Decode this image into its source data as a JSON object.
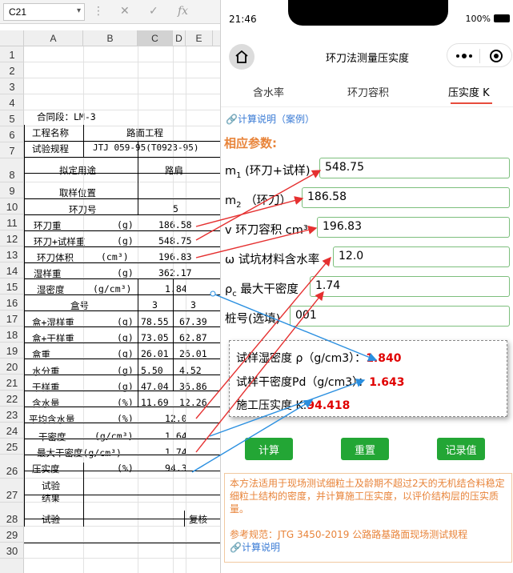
{
  "excel": {
    "name_box": "C21",
    "fx_label": "fx",
    "columns": [
      "A",
      "B",
      "C",
      "D",
      "E"
    ],
    "rows": [
      "1",
      "2",
      "3",
      "4",
      "5",
      "6",
      "7",
      "8",
      "9",
      "10",
      "11",
      "12",
      "13",
      "14",
      "15",
      "16",
      "17",
      "18",
      "19",
      "20",
      "21",
      "22",
      "23",
      "24",
      "25",
      "26",
      "27",
      "28",
      "29",
      "30"
    ],
    "contract": "合同段：LM-3",
    "project_label": "工程名称",
    "project_value": "路面工程",
    "spec_label": "试验规程",
    "spec_value": "JTJ 059-95(T0923-95)",
    "use_label": "拟定用途",
    "use_value": "路肩",
    "location_label": "取样位置",
    "ring_no_label": "环刀号",
    "ring_no_value": "5",
    "ring_weight_label": "环刀重",
    "ring_sample_label": "环刀+试样重",
    "ring_volume_label": "环刀体积",
    "wet_weight_label": "湿样重",
    "wet_density_label": "湿密度",
    "box_no_label": "盒号",
    "box_wet_label": "盒+湿样重",
    "box_dry_label": "盒+干样重",
    "box_label": "盒重",
    "water_label": "水分重",
    "dry_sample_label": "干样重",
    "moisture_label": "含水量",
    "avg_moisture_label": "平均含水量",
    "dry_density_label": "干密度",
    "max_dry_density_label": "最大干密度(g/cm³)",
    "compaction_label": "压实度",
    "result_label_1": "试验",
    "result_label_2": "结果",
    "tester_label": "试验",
    "reviewer_label": "复核",
    "unit_g": "(g)",
    "unit_density": "(g/cm³)",
    "unit_volume": "(cm³)",
    "unit_percent": "(%)",
    "ring_weight": "186.58",
    "ring_sample_weight": "548.75",
    "ring_volume": "196.83",
    "wet_weight": "362.17",
    "wet_density": "1.84",
    "box_no": [
      "3",
      "3"
    ],
    "box_wet": [
      "78.55",
      "67.39"
    ],
    "box_dry": [
      "73.05",
      "62.87"
    ],
    "box_weight": [
      "26.01",
      "26.01"
    ],
    "water_weight": [
      "5.50",
      "4.52"
    ],
    "dry_weight": [
      "47.04",
      "36.86"
    ],
    "moisture": [
      "11.69",
      "12.26"
    ],
    "avg_moisture": "12.0",
    "dry_density": "1.64",
    "max_dry_density": "1.74",
    "compaction": "94.3"
  },
  "app": {
    "time": "21:46",
    "battery": "100%",
    "title": "环刀法测量压实度",
    "tabs": [
      "含水率",
      "环刀容积",
      "压实度 K"
    ],
    "calc_link": "计算说明（案例）",
    "params_heading": "相应参数:",
    "fields": [
      {
        "label_main": "m",
        "label_sub": "1",
        "label_rest": " (环刀+试样)",
        "value": "548.75"
      },
      {
        "label_main": "m",
        "label_sub": "2",
        "label_rest": " （环刀）",
        "value": "186.58"
      },
      {
        "label_main": "v",
        "label_sub": "",
        "label_rest": " 环刀容积 cm³",
        "value": "196.83"
      },
      {
        "label_main": "ω",
        "label_sub": "",
        "label_rest": " 试坑材料含水率",
        "value": "12.0"
      },
      {
        "label_main": "ρ",
        "label_sub": "c",
        "label_rest": " 最大干密度",
        "value": "1.74"
      },
      {
        "label_main": "桩号(选填)",
        "label_sub": "",
        "label_rest": "",
        "value": "001"
      }
    ],
    "results": [
      {
        "label": "试样湿密度 ρ（g/cm3）：",
        "value": "1.840"
      },
      {
        "label": "试样干密度Pd（g/cm3）：",
        "value": "1.643"
      },
      {
        "label": "施工压实度 K:",
        "value": "94.418"
      }
    ],
    "buttons": [
      "计算",
      "重置",
      "记录值"
    ],
    "note": "本方法适用于现场测试细粒土及龄期不超过2天的无机结合料稳定细粒土结构的密度，并计算施工压实度，以评价结构层的压实质量。",
    "reference": "参考规范：JTG 3450-2019 公路路基路面现场测试规程",
    "note_link": "计算说明",
    "colors": {
      "accent": "#e74c3c",
      "button": "#23a635",
      "orange": "#e8843a",
      "link": "#3a7bd5",
      "red_value": "#e00000"
    }
  }
}
